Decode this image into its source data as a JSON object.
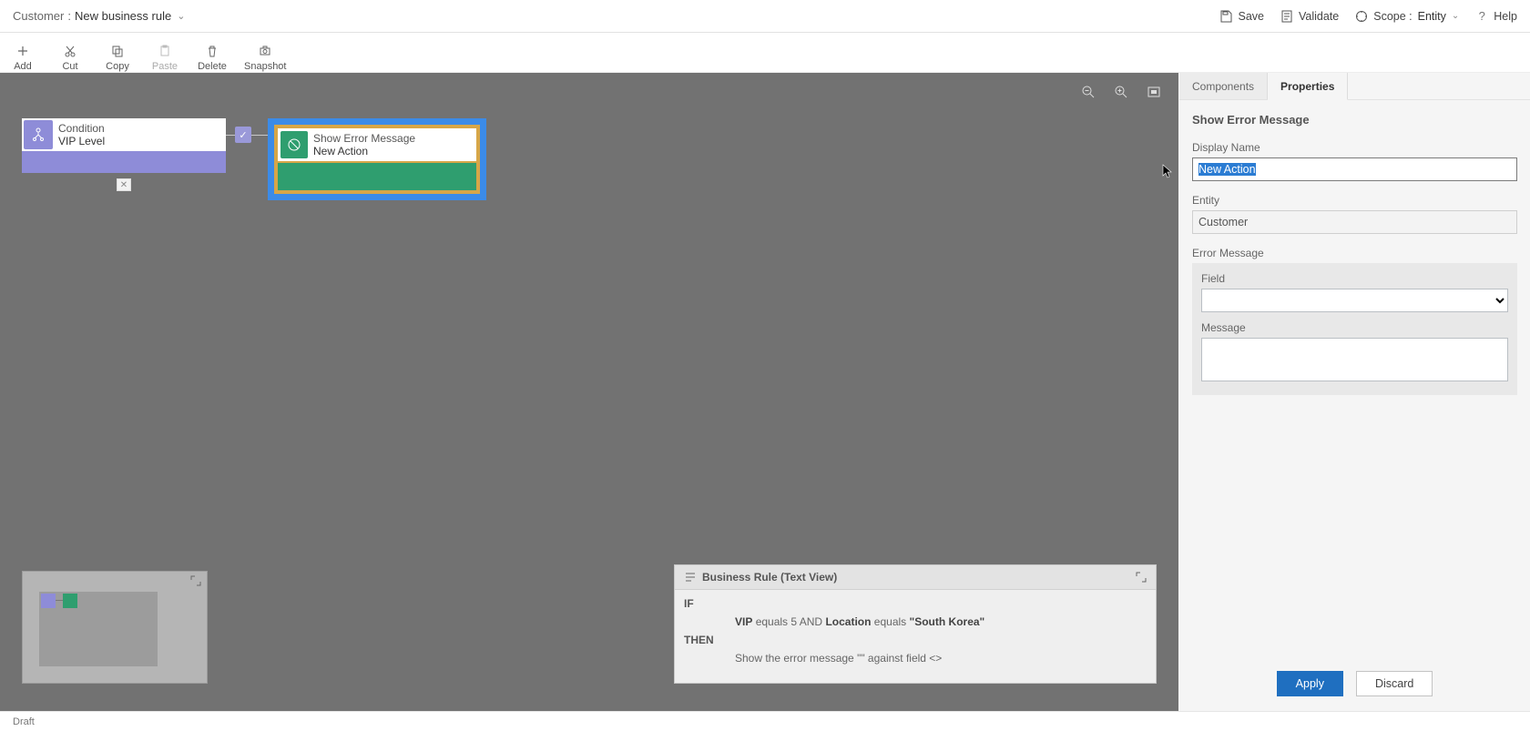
{
  "header": {
    "page_type": "Customer",
    "title": "New business rule",
    "actions": {
      "save": "Save",
      "validate": "Validate",
      "scope_label": "Scope :",
      "scope_value": "Entity",
      "help": "Help"
    }
  },
  "toolbar": {
    "add": "Add",
    "cut": "Cut",
    "copy": "Copy",
    "paste": "Paste",
    "delete": "Delete",
    "snapshot": "Snapshot"
  },
  "canvas": {
    "condition": {
      "type": "Condition",
      "name": "VIP Level"
    },
    "action": {
      "type": "Show Error Message",
      "name": "New Action"
    }
  },
  "textview": {
    "title": "Business Rule (Text View)",
    "if_kw": "IF",
    "then_kw": "THEN",
    "if_parts": {
      "f1": "VIP",
      "op1": "equals",
      "v1": "5",
      "and": "AND",
      "f2": "Location",
      "op2": "equals",
      "v2": "\"South Korea\""
    },
    "then_line": "Show the error message \"\" against field <>"
  },
  "panel": {
    "tabs": {
      "components": "Components",
      "properties": "Properties"
    },
    "heading": "Show Error Message",
    "display_name_label": "Display Name",
    "display_name_value": "New Action",
    "entity_label": "Entity",
    "entity_value": "Customer",
    "error_message_label": "Error Message",
    "field_label": "Field",
    "field_value": "",
    "message_label": "Message",
    "message_value": "",
    "apply": "Apply",
    "discard": "Discard"
  },
  "status": {
    "state": "Draft"
  }
}
